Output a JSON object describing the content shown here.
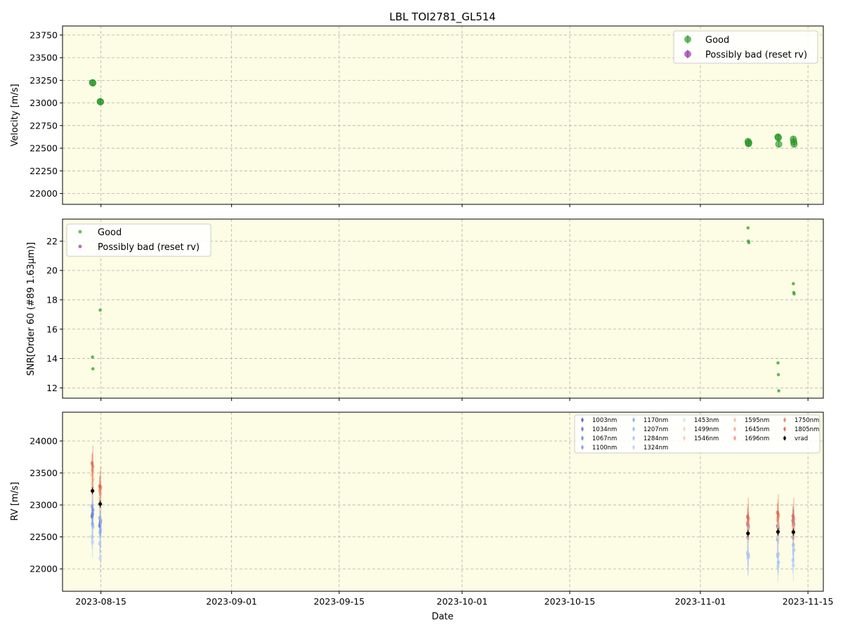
{
  "title": "LBL TOI2781_GL514",
  "colors": {
    "plot_bg": "#fdfce4",
    "good": "#2ca02c",
    "good_dark": "#138013",
    "bad": "#9b30a8",
    "grid": "#b0b0b0",
    "vrad": "#000000"
  },
  "x_axis": {
    "label": "Date",
    "range": [
      "2023-08-10",
      "2023-11-17"
    ],
    "ticks": [
      "2023-08-15",
      "2023-09-01",
      "2023-09-15",
      "2023-10-01",
      "2023-10-15",
      "2023-11-01",
      "2023-11-15"
    ]
  },
  "chart_data": [
    {
      "type": "scatter",
      "panel": "velocity",
      "ylabel": "Velocity [m/s]",
      "ylim": [
        21880,
        23850
      ],
      "yticks": [
        22000,
        22250,
        22500,
        22750,
        23000,
        23250,
        23500,
        23750
      ],
      "grid": true,
      "legend_position": "top-right",
      "series": [
        {
          "name": "Good",
          "x": [
            "2023-08-13.9",
            "2023-08-13.95",
            "2023-08-14.9",
            "2023-08-14.95",
            "2023-11-07.2",
            "2023-11-07.25",
            "2023-11-07.3",
            "2023-11-11.1",
            "2023-11-11.15",
            "2023-11-11.2",
            "2023-11-13.1",
            "2023-11-13.15",
            "2023-11-13.2"
          ],
          "y": [
            23225,
            23220,
            23015,
            23012,
            22575,
            22550,
            22560,
            22625,
            22615,
            22545,
            22600,
            22570,
            22545
          ]
        },
        {
          "name": "Possibly bad (reset rv)",
          "x": [],
          "y": []
        }
      ]
    },
    {
      "type": "scatter",
      "panel": "snr",
      "ylabel": "SNR[Order 60 (#89 1.63μm)]",
      "ylim": [
        11.3,
        23.5
      ],
      "yticks": [
        12,
        14,
        16,
        18,
        20,
        22
      ],
      "grid": true,
      "legend_position": "top-left",
      "series": [
        {
          "name": "Good",
          "x": [
            "2023-08-13.9",
            "2023-08-13.95",
            "2023-08-14.9",
            "2023-11-07.2",
            "2023-11-07.25",
            "2023-11-07.3",
            "2023-11-11.1",
            "2023-11-11.15",
            "2023-11-11.2",
            "2023-11-13.1",
            "2023-11-13.15",
            "2023-11-13.2"
          ],
          "y": [
            14.1,
            13.3,
            17.3,
            22.9,
            22.0,
            21.9,
            13.7,
            12.9,
            11.8,
            19.1,
            18.5,
            18.4
          ]
        },
        {
          "name": "Possibly bad (reset rv)",
          "x": [],
          "y": []
        }
      ]
    },
    {
      "type": "scatter",
      "panel": "rv",
      "ylabel": "RV [m/s]",
      "ylim": [
        21650,
        24450
      ],
      "yticks": [
        22000,
        22500,
        23000,
        23500,
        24000
      ],
      "grid": true,
      "legend_position": "top-right",
      "epochs": [
        "2023-08-13.9",
        "2023-08-14.9",
        "2023-11-07.2",
        "2023-11-11.1",
        "2023-11-13.1"
      ],
      "vrad": [
        23220,
        23015,
        22555,
        22580,
        22575
      ],
      "series": [
        {
          "name": "1003nm",
          "color": "#3b4cc0",
          "offset": [
            -400,
            -340,
            150,
            90,
            180
          ]
        },
        {
          "name": "1034nm",
          "color": "#4961d2",
          "offset": [
            -360,
            -300,
            130,
            70,
            150
          ]
        },
        {
          "name": "1067nm",
          "color": "#5977e3",
          "offset": [
            -300,
            -260,
            100,
            50,
            120
          ]
        },
        {
          "name": "1100nm",
          "color": "#6a8bef",
          "offset": [
            -240,
            -220,
            -60,
            -120,
            -80
          ]
        },
        {
          "name": "1170nm",
          "color": "#7b9ff9",
          "offset": [
            -520,
            -440,
            -330,
            -350,
            -200
          ]
        },
        {
          "name": "1207nm",
          "color": "#8db0fe",
          "offset": [
            -560,
            -400,
            -360,
            -480,
            -280
          ]
        },
        {
          "name": "1284nm",
          "color": "#9ebeff",
          "offset": [
            -720,
            -620,
            -300,
            -380,
            -440
          ]
        },
        {
          "name": "1324nm",
          "color": "#b0cbff",
          "offset": [
            -800,
            -850,
            -380,
            -540,
            -520
          ]
        },
        {
          "name": "1453nm",
          "color": "#dcdddd",
          "offset": [
            40,
            -60,
            -80,
            -100,
            -30
          ]
        },
        {
          "name": "1499nm",
          "color": "#eacfc1",
          "offset": [
            120,
            80,
            20,
            -40,
            50
          ]
        },
        {
          "name": "1546nm",
          "color": "#f4c6ad",
          "offset": [
            60,
            40,
            -20,
            60,
            20
          ]
        },
        {
          "name": "1595nm",
          "color": "#f5b69a",
          "offset": [
            180,
            160,
            80,
            120,
            70
          ]
        },
        {
          "name": "1645nm",
          "color": "#f4a282",
          "offset": [
            250,
            200,
            140,
            180,
            110
          ]
        },
        {
          "name": "1696nm",
          "color": "#ef8a6d",
          "offset": [
            320,
            230,
            180,
            220,
            160
          ]
        },
        {
          "name": "1750nm",
          "color": "#e46f57",
          "offset": [
            380,
            260,
            230,
            260,
            210
          ]
        },
        {
          "name": "1805nm",
          "color": "#d65244",
          "offset": [
            430,
            280,
            260,
            300,
            250
          ]
        },
        {
          "name": "vrad",
          "color": "#000000",
          "offset": [
            0,
            0,
            0,
            0,
            0
          ]
        }
      ]
    }
  ]
}
